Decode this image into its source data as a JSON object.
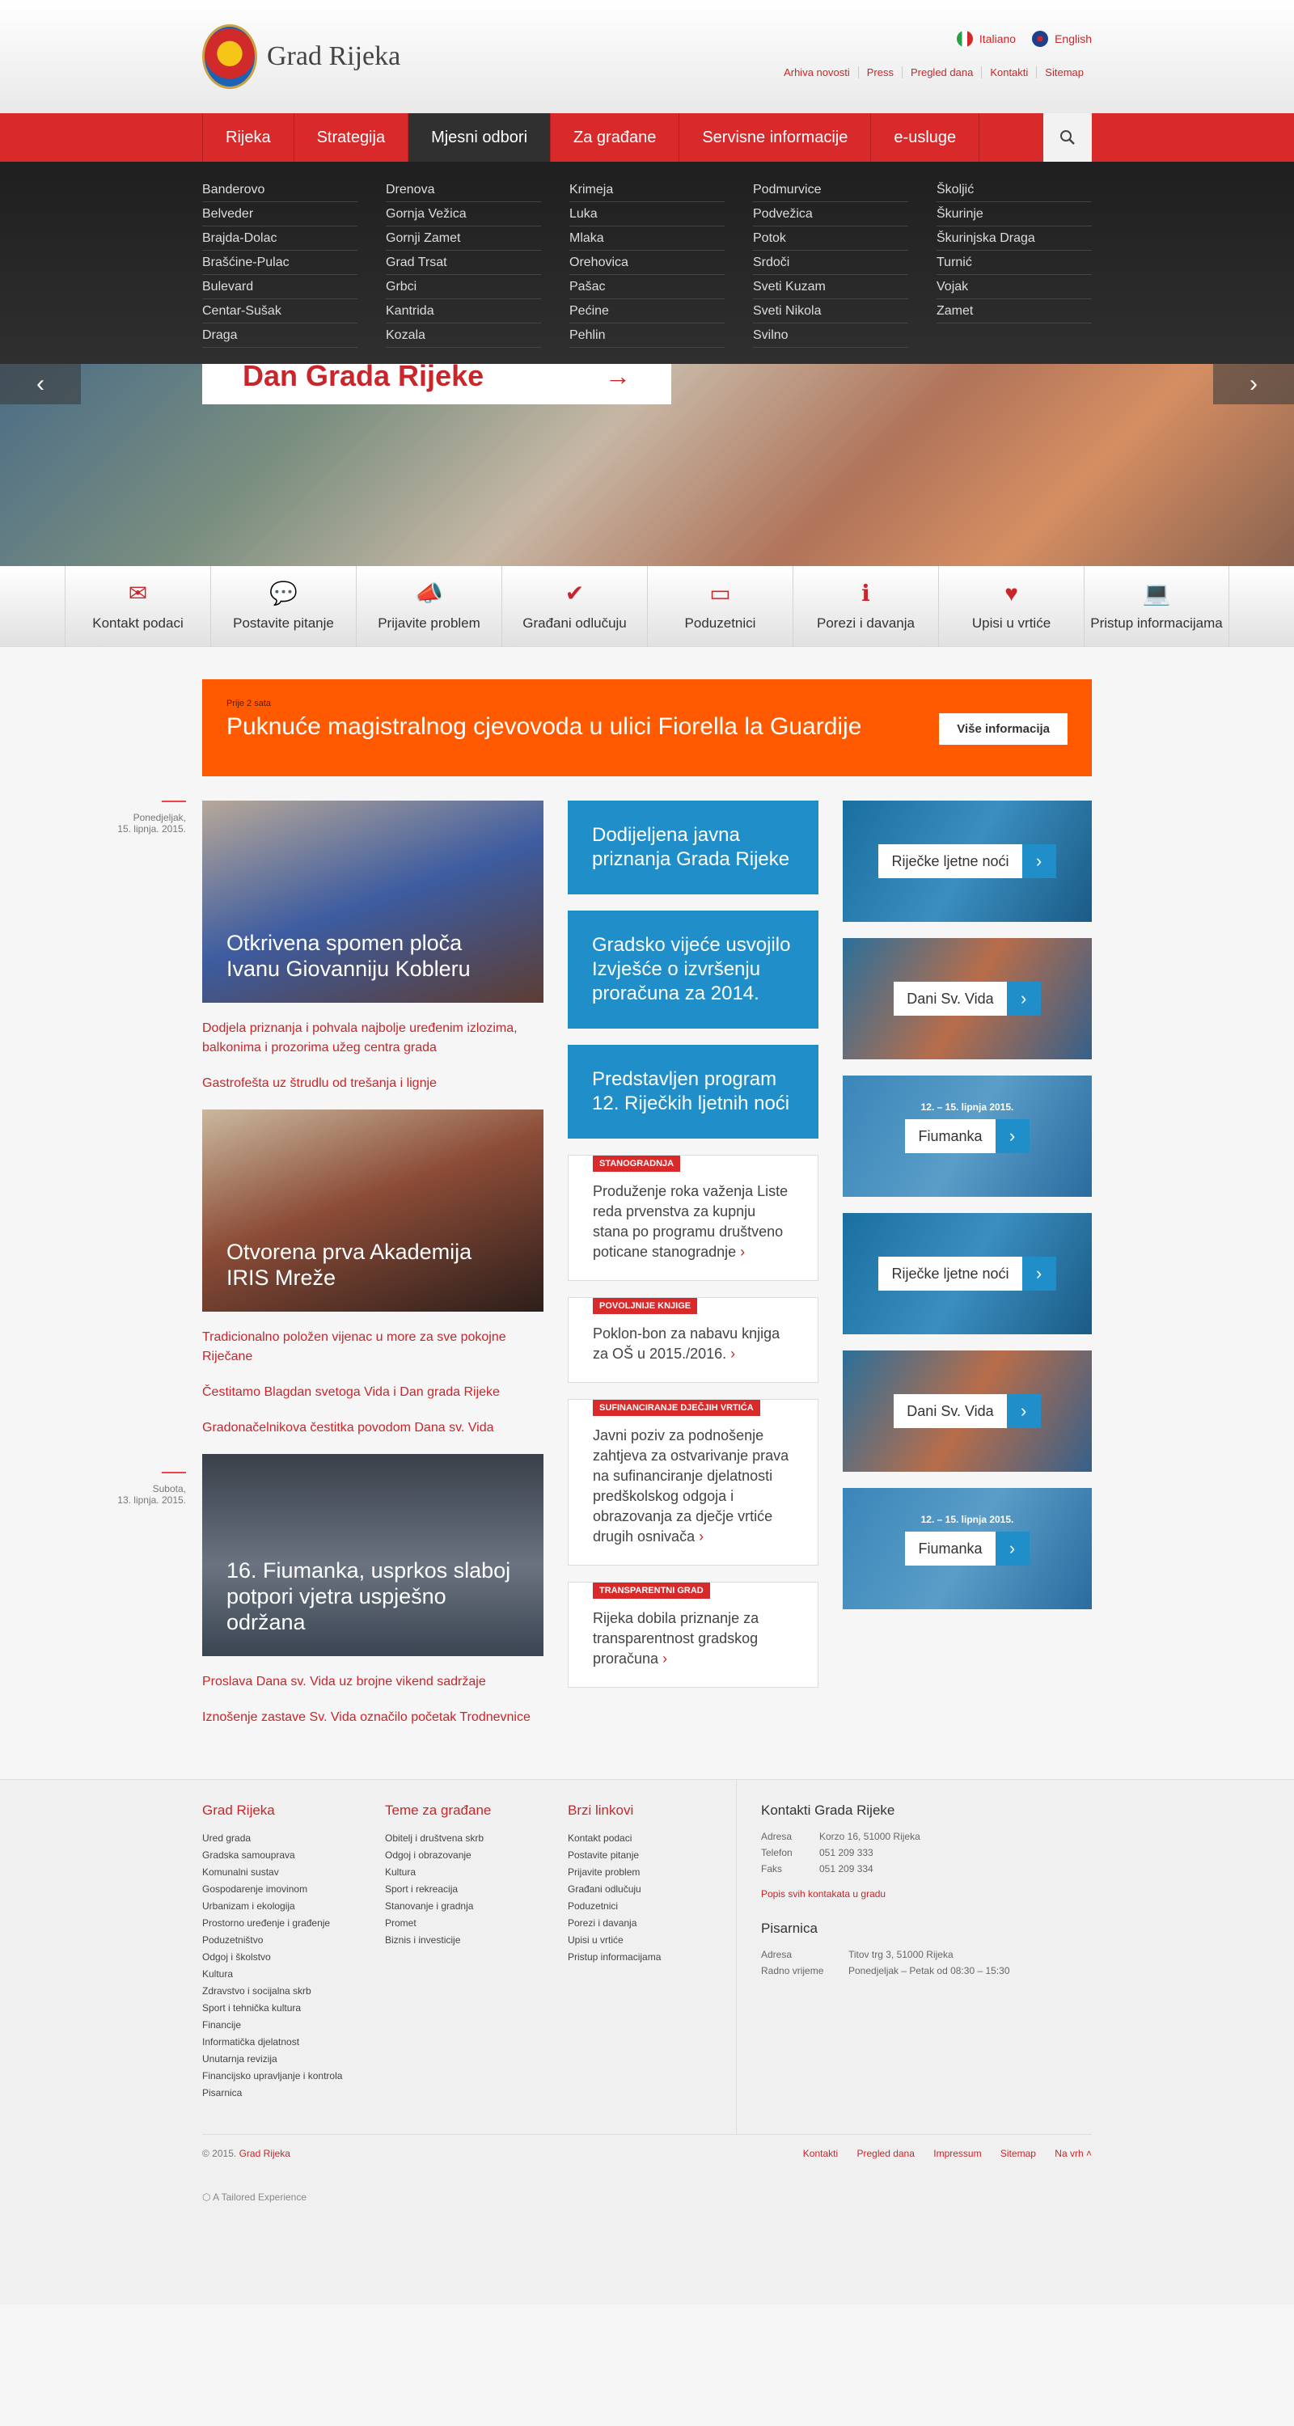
{
  "header": {
    "site_name": "Grad Rijeka",
    "lang_it": "Italiano",
    "lang_en": "English",
    "top_links": [
      "Arhiva novosti",
      "Press",
      "Pregled dana",
      "Kontakti",
      "Sitemap"
    ]
  },
  "nav": {
    "items": [
      "Rijeka",
      "Strategija",
      "Mjesni odbori",
      "Za građane",
      "Servisne informacije",
      "e-usluge"
    ]
  },
  "dropdown": {
    "columns": [
      [
        "Banderovo",
        "Belveder",
        "Brajda-Dolac",
        "Brašćine-Pulac",
        "Bulevard",
        "Centar-Sušak",
        "Draga"
      ],
      [
        "Drenova",
        "Gornja Vežica",
        "Gornji Zamet",
        "Grad Trsat",
        "Grbci",
        "Kantrida",
        "Kozala"
      ],
      [
        "Krimeja",
        "Luka",
        "Mlaka",
        "Orehovica",
        "Pašac",
        "Pećine",
        "Pehlin"
      ],
      [
        "Podmurvice",
        "Podvežica",
        "Potok",
        "Srdoči",
        "Sveti Kuzam",
        "Sveti Nikola",
        "Svilno"
      ],
      [
        "Školjić",
        "Škurinje",
        "Škurinjska Draga",
        "Turnić",
        "Vojak",
        "Zamet"
      ]
    ]
  },
  "hero": {
    "title": "Dan Grada Rijeke",
    "arrow": "→",
    "prev": "‹",
    "next": "›"
  },
  "quick": [
    {
      "icon": "✉",
      "label": "Kontakt podaci"
    },
    {
      "icon": "💬",
      "label": "Postavite pitanje"
    },
    {
      "icon": "📣",
      "label": "Prijavite problem"
    },
    {
      "icon": "✔",
      "label": "Građani odlučuju"
    },
    {
      "icon": "▭",
      "label": "Poduzetnici"
    },
    {
      "icon": "ℹ",
      "label": "Porezi i davanja"
    },
    {
      "icon": "♥",
      "label": "Upisi u vrtiće"
    },
    {
      "icon": "💻",
      "label": "Pristup informacijama"
    }
  ],
  "alert": {
    "time": "Prije 2 sata",
    "title": "Puknuće magistralnog cjevovoda u ulici Fiorella la Guardije",
    "button": "Više informacija"
  },
  "dates": [
    {
      "day": "Ponedjeljak,",
      "date": "15. lipnja. 2015."
    },
    {
      "day": "Subota,",
      "date": "13. lipnja. 2015."
    }
  ],
  "features": [
    {
      "title": "Otkrivena spomen ploča Ivanu Giovanniju Kobleru",
      "links": [
        "Dodjela priznanja i pohvala najbolje uređenim izlozima, balkonima i prozorima užeg centra grada",
        "Gastrofešta uz štrudlu od trešanja i lignje"
      ]
    },
    {
      "title": "Otvorena prva Akademija IRIS Mreže",
      "links": [
        "Tradicionalno položen vijenac u more za sve pokojne Riječane",
        "Čestitamo Blagdan svetoga Vida i Dan grada Rijeke",
        "Gradonačelnikova čestitka povodom Dana sv. Vida"
      ]
    },
    {
      "title": "16. Fiumanka, usprkos slaboj potpori vjetra uspješno održana",
      "links": [
        "Proslava Dana sv. Vida uz brojne vikend sadržaje",
        "Iznošenje zastave Sv. Vida označilo početak Trodnevnice"
      ]
    }
  ],
  "blue_boxes": [
    "Dodijeljena javna priznanja Grada Rijeke",
    "Gradsko vijeće usvojilo Izvješće o izvršenju proračuna za 2014.",
    "Predstavljen program 12. Riječkih ljetnih noći"
  ],
  "cards": [
    {
      "tag": "STANOGRADNJA",
      "text": "Produženje roka važenja Liste reda prvenstva za kupnju stana po programu društveno poticane stanogradnje"
    },
    {
      "tag": "POVOLJNIJE KNJIGE",
      "text": "Poklon-bon za nabavu knjiga za OŠ u 2015./2016."
    },
    {
      "tag": "SUFINANCIRANJE DJEČJIH VRTIĆA",
      "text": "Javni poziv za podnošenje zahtjeva za ostvarivanje prava na sufinanciranje djelatnosti predškolskog odgoja i obrazovanja za dječje vrtiće drugih osnivača"
    },
    {
      "tag": "TRANSPARENTNI GRAD",
      "text": "Rijeka dobila priznanje za transparentnost gradskog proračuna"
    }
  ],
  "promos": [
    {
      "label": "Riječke ljetne noći",
      "date": ""
    },
    {
      "label": "Dani Sv. Vida",
      "date": ""
    },
    {
      "label": "Fiumanka",
      "date": "12. – 15. lipnja 2015."
    },
    {
      "label": "Riječke ljetne noći",
      "date": ""
    },
    {
      "label": "Dani Sv. Vida",
      "date": ""
    },
    {
      "label": "Fiumanka",
      "date": "12. – 15. lipnja 2015."
    }
  ],
  "footer": {
    "col1": {
      "title": "Grad Rijeka",
      "items": [
        "Ured grada",
        "Gradska samouprava",
        "Komunalni sustav",
        "Gospodarenje imovinom",
        "Urbanizam i ekologija",
        "Prostorno uređenje i građenje",
        "Poduzetništvo",
        "Odgoj i školstvo",
        "Kultura",
        "Zdravstvo i socijalna skrb",
        "Sport i tehnička kultura",
        "Financije",
        "Informatička djelatnost",
        "Unutarnja revizija",
        "Financijsko upravljanje i kontrola",
        "Pisarnica"
      ]
    },
    "col2": {
      "title": "Teme za građane",
      "items": [
        "Obitelj i društvena skrb",
        "Odgoj i obrazovanje",
        "Kultura",
        "Sport i rekreacija",
        "Stanovanje i gradnja",
        "Promet",
        "Biznis i investicije"
      ]
    },
    "col3": {
      "title": "Brzi linkovi",
      "items": [
        "Kontakt podaci",
        "Postavite pitanje",
        "Prijavite problem",
        "Građani odlučuju",
        "Poduzetnici",
        "Porezi i davanja",
        "Upisi u vrtiće",
        "Pristup informacijama"
      ]
    },
    "contact": {
      "title": "Kontakti Grada Rijeke",
      "rows": [
        [
          "Adresa",
          "Korzo 16, 51000 Rijeka"
        ],
        [
          "Telefon",
          "051 209 333"
        ],
        [
          "Faks",
          "051 209 334"
        ]
      ],
      "all_link": "Popis svih kontakata u gradu",
      "office_title": "Pisarnica",
      "office_rows": [
        [
          "Adresa",
          "Titov trg 3, 51000 Rijeka"
        ],
        [
          "Radno vrijeme",
          "Ponedjeljak – Petak od 08:30 – 15:30"
        ]
      ]
    },
    "copyright": "© 2015.",
    "copyright_link": "Grad Rijeka",
    "bottom_links": [
      "Kontakti",
      "Pregled dana",
      "Impressum",
      "Sitemap",
      "Na vrh"
    ],
    "tailored": "A Tailored Experience"
  }
}
